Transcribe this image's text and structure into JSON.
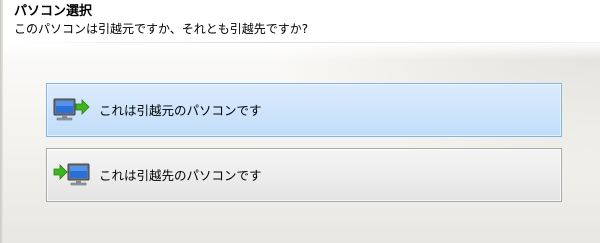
{
  "header": {
    "title": "パソコン選択",
    "subtitle": "このパソコンは引越元ですか、それとも引越先ですか?"
  },
  "options": [
    {
      "label": "これは引越元のパソコンです",
      "icon": "pc-send-icon",
      "selected": true
    },
    {
      "label": "これは引越先のパソコンです",
      "icon": "pc-receive-icon",
      "selected": false
    }
  ],
  "colors": {
    "selected_border": "#7eb4ea",
    "selected_fill": "#cfe4fb",
    "normal_border": "#a9a9a9",
    "normal_fill": "#ededed",
    "arrow_green": "#3fb51f",
    "monitor_blue": "#2a6fd6"
  }
}
